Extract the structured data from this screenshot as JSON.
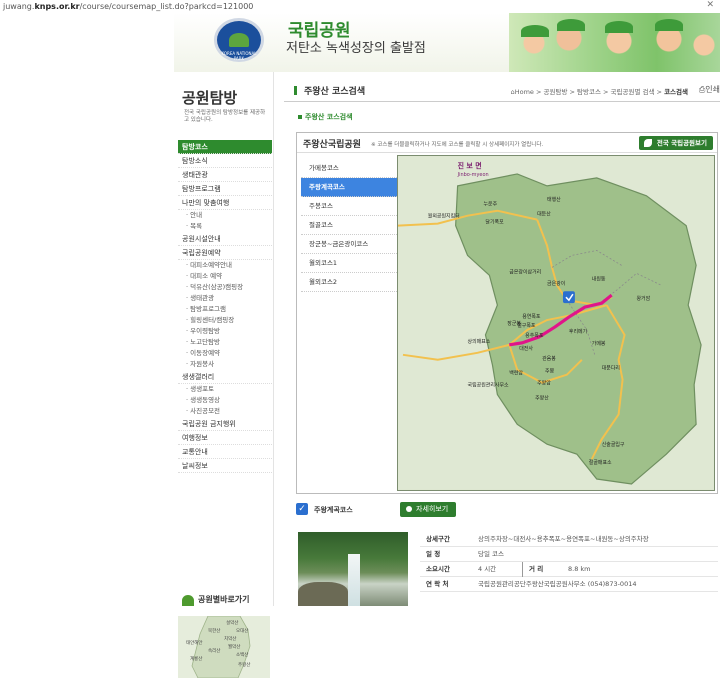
{
  "browser": {
    "url_prefix": "juwang.",
    "url_domain": "knps.or.kr",
    "url_path": "/course/coursemap_list.do?parkcd=121000",
    "close_symbol": "✕"
  },
  "header": {
    "logo_text": "KOREA NATIONAL PARK",
    "brand_title": "국립공원",
    "brand_slogan": "저탄소 녹색성장의 출발점"
  },
  "sidebar": {
    "title": "공원탐방",
    "description": "전국 국립공원의 탐방정보를 제공하고 있습니다.",
    "items": [
      {
        "label": "탐방코스",
        "type": "item",
        "active": true
      },
      {
        "label": "탐방소식",
        "type": "item"
      },
      {
        "label": "생태관광",
        "type": "item"
      },
      {
        "label": "탐방프로그램",
        "type": "item"
      },
      {
        "label": "나만의 맞춤여행",
        "type": "item"
      },
      {
        "label": "· 안내",
        "type": "sub"
      },
      {
        "label": "· 목록",
        "type": "sub"
      },
      {
        "label": "공원시설안내",
        "type": "item"
      },
      {
        "label": "국립공원예약",
        "type": "item"
      },
      {
        "label": "· 대피소예약안내",
        "type": "sub"
      },
      {
        "label": "· 대피소 예약",
        "type": "sub"
      },
      {
        "label": "· 덕유산(삼공)캠핑장",
        "type": "sub"
      },
      {
        "label": "· 생태관광",
        "type": "sub"
      },
      {
        "label": "· 탐방프로그램",
        "type": "sub"
      },
      {
        "label": "· 힐링센터/캠핑장",
        "type": "sub"
      },
      {
        "label": "· 우이령탐방",
        "type": "sub"
      },
      {
        "label": "· 노고단탐방",
        "type": "sub"
      },
      {
        "label": "· 이동장예약",
        "type": "sub"
      },
      {
        "label": "· 자원봉사",
        "type": "sub"
      },
      {
        "label": "생생갤러리",
        "type": "item"
      },
      {
        "label": "· 생생포토",
        "type": "sub"
      },
      {
        "label": "· 생생동영상",
        "type": "sub"
      },
      {
        "label": "· 사진공모전",
        "type": "sub"
      },
      {
        "label": "국립공원 금지행위",
        "type": "item"
      },
      {
        "label": "여행정보",
        "type": "item"
      },
      {
        "label": "교통안내",
        "type": "item"
      },
      {
        "label": "날씨정보",
        "type": "item"
      }
    ],
    "quick_title": "공원별바로가기",
    "minimap_labels": [
      "설악산",
      "북한산",
      "오대산",
      "치악산",
      "태안해안",
      "월악산",
      "속리산",
      "계룡산",
      "소백산",
      "주왕산"
    ]
  },
  "page": {
    "title": "주왕산 코스검색",
    "breadcrumb": [
      "Home",
      "공원탐방",
      "탐방코스",
      "국립공원별 검색",
      "코스검색"
    ],
    "breadcrumb_home_icon": "⌂",
    "print_label": "인쇄",
    "subhead": "주왕산 코스검색"
  },
  "mapbox": {
    "title": "주왕산국립공원",
    "note": "※ 코스를 더블클릭하거나 지도에 코스를 클릭할 시 상세페이지가 열립니다.",
    "all_parks_button": "전국 국립공원보기",
    "courses": [
      {
        "label": "가메봉코스"
      },
      {
        "label": "주왕계곡코스",
        "active": true
      },
      {
        "label": "주봉코스"
      },
      {
        "label": "절골코스"
      },
      {
        "label": "장군봉~금은광이코스"
      },
      {
        "label": "월외코스1"
      },
      {
        "label": "월외코스2"
      }
    ],
    "map_labels": {
      "district": "진 보 면",
      "district_en": "Jinbo-myeon",
      "p1": "월외공원지킴터",
      "p2": "누운주",
      "p3": "달기폭포",
      "p4": "태행산",
      "p5": "대둔산",
      "p6": "금은광이",
      "p7": "금은광이삼거리",
      "p8": "내원동",
      "p9": "왕거암",
      "p10": "장군봉",
      "p11": "용연폭포",
      "p12": "절구폭포",
      "p13": "용추폭포",
      "p14": "후리메기",
      "p15": "가메봉",
      "p16": "대전사",
      "p17": "관음봉",
      "p18": "주봉",
      "p19": "상의매표소",
      "p20": "주왕암",
      "p21": "주왕산",
      "p22": "국립공원관리사무소",
      "p23": "백련암",
      "p24": "대문다리",
      "p25": "신술골입구",
      "p26": "절골매표소"
    }
  },
  "selected": {
    "checkbox_symbol": "✓",
    "course_label": "주왕계곡코스",
    "detail_button": "자세히보기"
  },
  "details": {
    "rows": [
      {
        "key": "상세구간",
        "value": "상의주차장~대전사~용추폭포~용연폭포~내원동~상의주차장"
      },
      {
        "key": "일 정",
        "value": "당일 코스"
      },
      {
        "key": "소요시간",
        "value": "4 시간",
        "key2": "거 리",
        "value2": "8.8 km"
      },
      {
        "key": "연 락 처",
        "value": "국립공원관리공단주왕산국립공원사무소 (054)873-0014"
      }
    ]
  },
  "colors": {
    "brand_green": "#2e8b2e",
    "active_blue": "#3d84e0",
    "course_route": "#e0148a"
  }
}
